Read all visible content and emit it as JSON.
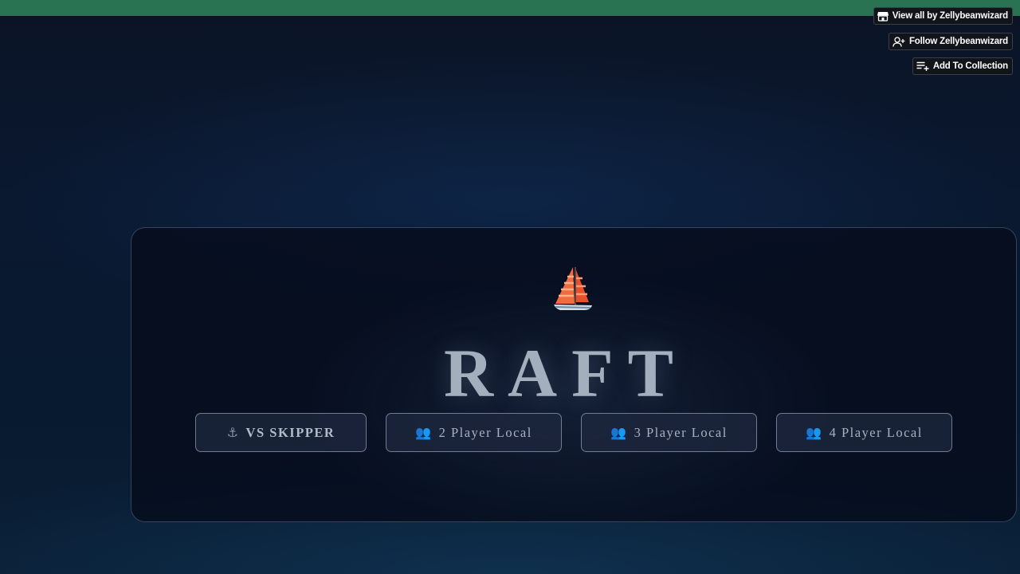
{
  "itch_bar": {
    "view_all_label": "View all by Zellybeanwizard",
    "follow_label": "Follow Zellybeanwizard",
    "collection_label": "Add To Collection",
    "bar_color": "#2a7352"
  },
  "game": {
    "logo_icon": "sailboat-icon",
    "title": "RAFT",
    "modes": [
      {
        "icon": "anchor-icon",
        "glyph": "⚓",
        "label": "VS SKIPPER"
      },
      {
        "icon": "people-icon",
        "glyph": "👥",
        "label": "2 Player Local"
      },
      {
        "icon": "people-icon",
        "glyph": "👥",
        "label": "3 Player Local"
      },
      {
        "icon": "people-icon",
        "glyph": "👥",
        "label": "4 Player Local"
      }
    ]
  }
}
